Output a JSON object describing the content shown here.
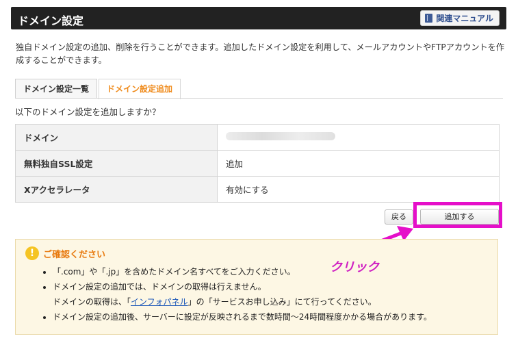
{
  "header": {
    "title": "ドメイン設定",
    "manual_label": "関連マニュアル"
  },
  "description": "独自ドメイン設定の追加、削除を行うことができます。追加したドメイン設定を利用して、メールアカウントやFTPアカウントを作成することができます。",
  "tabs": [
    {
      "label": "ドメイン設定一覧"
    },
    {
      "label": "ドメイン設定追加"
    }
  ],
  "question": "以下のドメイン設定を追加しますか？",
  "table": {
    "rows": [
      {
        "key": "ドメイン",
        "value": ""
      },
      {
        "key": "無料独自SSL設定",
        "value": "追加"
      },
      {
        "key": "Xアクセラレータ",
        "value": "有効にする"
      }
    ]
  },
  "buttons": {
    "back": "戻る",
    "add": "追加する"
  },
  "annotation": {
    "click_label": "クリック",
    "highlight_color": "#e50fc9"
  },
  "notice": {
    "icon": "!",
    "title": "ご確認ください",
    "item1": "「.com」や「.jp」を含めたドメイン名すべてをご入力ください。",
    "item2": "ドメイン設定の追加では、ドメインの取得は行えません。",
    "item2_sub_prefix": "ドメインの取得は、「",
    "item2_sub_link": "インフォパネル",
    "item2_sub_suffix": "」の「サービスお申し込み」にて行ってください。",
    "item3": "ドメイン設定の追加後、サーバーに設定が反映されるまで数時間〜24時間程度かかる場合があります。"
  }
}
